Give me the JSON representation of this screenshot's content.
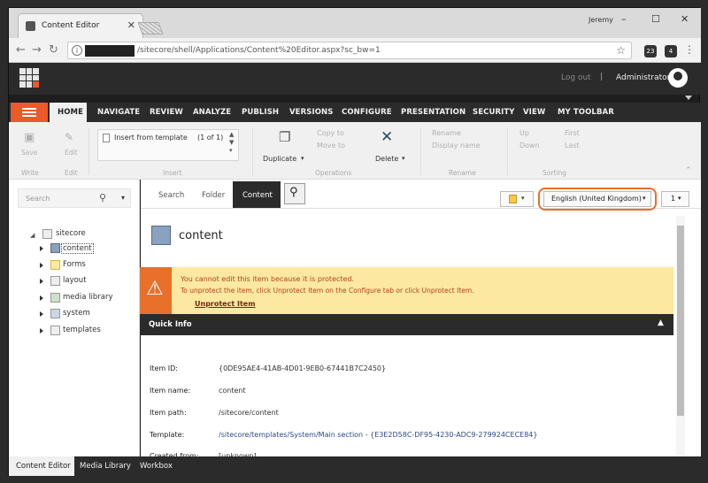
{
  "browser": {
    "tab_title": "Content Editor",
    "user": "Jeremy",
    "url": "/sitecore/shell/Applications/Content%20Editor.aspx?sc_bw=1",
    "window_buttons": [
      "–",
      "☐",
      "✕"
    ],
    "ext1": "23",
    "ext2": "4"
  },
  "header": {
    "logout": "Log out",
    "separator": "|",
    "username": "Administrator"
  },
  "ribbon_tabs": [
    "HOME",
    "NAVIGATE",
    "REVIEW",
    "ANALYZE",
    "PUBLISH",
    "VERSIONS",
    "CONFIGURE",
    "PRESENTATION",
    "SECURITY",
    "VIEW",
    "MY TOOLBAR"
  ],
  "ribbon": {
    "save": "Save",
    "edit": "Edit",
    "write_group": "Write",
    "edit_group": "Edit",
    "insert_from_template": "Insert from template",
    "insert_count": "(1 of 1)",
    "insert_group": "Insert",
    "duplicate": "Duplicate",
    "delete": "Delete",
    "copy_to": "Copy to",
    "move_to": "Move to",
    "operations_group": "Operations",
    "rename": "Rename",
    "display_name": "Display name",
    "rename_group": "Rename",
    "up": "Up",
    "down": "Down",
    "first": "First",
    "last": "Last",
    "sorting_group": "Sorting"
  },
  "left": {
    "search_placeholder": "Search",
    "tree": [
      {
        "label": "sitecore"
      },
      {
        "label": "content"
      },
      {
        "label": "Forms"
      },
      {
        "label": "layout"
      },
      {
        "label": "media library"
      },
      {
        "label": "system"
      },
      {
        "label": "templates"
      }
    ]
  },
  "main": {
    "tabs": [
      "Search",
      "Folder",
      "Content"
    ],
    "language": "English (United Kingdom)",
    "version": "1",
    "item_title": "content",
    "warning_title": "You cannot edit this item because it is protected.",
    "warning_text": "To unprotect the item, click Unprotect Item on the Configure tab or click Unprotect Item.",
    "warning_link": "Unprotect Item",
    "quick_info": "Quick Info",
    "fields": [
      {
        "label": "Item ID:",
        "value": "{0DE95AE4-41AB-4D01-9EB0-67441B7C2450}"
      },
      {
        "label": "Item name:",
        "value": "content"
      },
      {
        "label": "Item path:",
        "value": "/sitecore/content"
      },
      {
        "label": "Template:",
        "value": "/sitecore/templates/System/Main section - {E3E2D58C-DF95-4230-ADC9-279924CECE84}"
      },
      {
        "label": "Created from:",
        "value": "[unknown]"
      }
    ]
  },
  "bottom_tabs": [
    "Content Editor",
    "Media Library",
    "Workbox"
  ],
  "colors": {
    "accent": "#eb5a28",
    "dark": "#2b2b2b",
    "warning": "#fce8a1"
  }
}
